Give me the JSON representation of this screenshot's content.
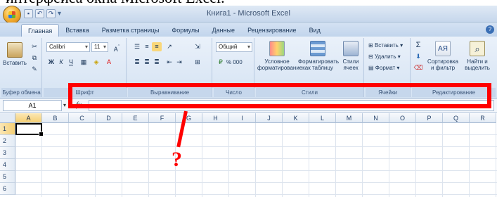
{
  "caption": "интерфейса окна Microsoft Excel.",
  "window": {
    "title": "Книга1 - Microsoft Excel"
  },
  "quick_access": [
    "save-icon",
    "undo-icon",
    "redo-icon"
  ],
  "tabs": [
    {
      "label": "Главная",
      "active": true
    },
    {
      "label": "Вставка"
    },
    {
      "label": "Разметка страницы"
    },
    {
      "label": "Формулы"
    },
    {
      "label": "Данные"
    },
    {
      "label": "Рецензирование"
    },
    {
      "label": "Вид"
    }
  ],
  "ribbon": {
    "clipboard": {
      "paste": "Вставить",
      "label": "Буфер обмена"
    },
    "font": {
      "name": "Calibri",
      "size": "11",
      "label": "Шрифт"
    },
    "alignment": {
      "label": "Выравнивание"
    },
    "number": {
      "format": "Общий",
      "percent": "% 000",
      "label": "Число"
    },
    "styles": {
      "conditional": "Условное форматирование",
      "format_table": "Форматировать как таблицу",
      "cell_styles": "Стили ячеек",
      "label": "Стили"
    },
    "cells": {
      "insert": "Вставить",
      "delete": "Удалить",
      "format": "Формат",
      "label": "Ячейки"
    },
    "editing": {
      "sort": "Сортировка и фильтр",
      "find": "Найти и выделить",
      "label": "Редактирование"
    }
  },
  "formula_bar": {
    "name_box": "A1",
    "fx": "fx",
    "value": ""
  },
  "grid": {
    "columns": [
      "A",
      "B",
      "C",
      "D",
      "E",
      "F",
      "G",
      "H",
      "I",
      "J",
      "K",
      "L",
      "M",
      "N",
      "O",
      "P",
      "Q",
      "R"
    ],
    "rows": [
      "1",
      "2",
      "3",
      "4",
      "5",
      "6"
    ],
    "active_cell": "A1"
  },
  "annotation": {
    "symbol": "?",
    "color": "#ff0000"
  }
}
